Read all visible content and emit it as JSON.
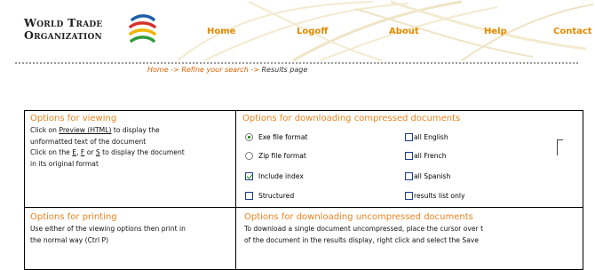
{
  "header": {
    "logo_line1": "World Trade",
    "logo_line2": "Organization",
    "nav": [
      "Home",
      "Logoff",
      "About",
      "Help",
      "Contact"
    ]
  },
  "breadcrumb": {
    "home": "Home",
    "sep1": " -> ",
    "refine": "Refine your search",
    "sep2": " -> ",
    "current": "Results page"
  },
  "viewing": {
    "title": "Options for viewing",
    "line1_pre": "Click on ",
    "line1_link": "Preview (HTML)",
    "line1_post": " to display the",
    "line2": "unformatted  text of the document",
    "line3_pre": "Click on the ",
    "e": "E",
    "comma1": ", ",
    "f": "F",
    "or": " or ",
    "s": "S",
    "line3_post": " to display the document",
    "line4": "in its original format"
  },
  "downloading_compressed": {
    "title": "Options for downloading compressed documents",
    "options": [
      {
        "label": "Exe file format",
        "type": "radio",
        "checked": true
      },
      {
        "label": "Zip file format",
        "type": "radio",
        "checked": false
      },
      {
        "label": "Include index",
        "type": "checkbox",
        "checked": true
      },
      {
        "label": "Structured",
        "type": "checkbox",
        "checked": false
      }
    ],
    "languages": [
      {
        "label": "all English",
        "checked": false
      },
      {
        "label": "all French",
        "checked": false
      },
      {
        "label": "all Spanish",
        "checked": false
      },
      {
        "label": "results list only",
        "checked": false
      }
    ]
  },
  "printing": {
    "title": "Options for printing",
    "line1": "Use either of the viewing options then print in",
    "line2": "the normal way (Ctrl P)"
  },
  "downloading_uncompressed": {
    "title": "Options for downloading uncompressed documents",
    "line1": "To download a single document uncompressed, place the cursor over t",
    "line2": "of the document in the results display, right click and select the Save"
  },
  "colors": {
    "accent": "#e8841f",
    "nav": "#e58a00",
    "border": "#000000"
  },
  "icons": [
    "wto-logo",
    "radio-selected",
    "radio-unselected",
    "checkbox-checked",
    "checkbox-unchecked"
  ]
}
